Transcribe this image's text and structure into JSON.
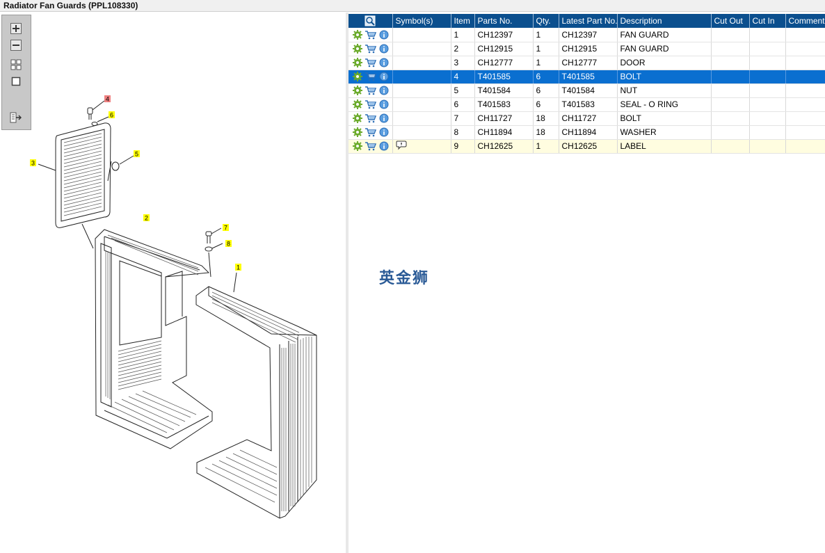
{
  "window": {
    "title": "Radiator Fan Guards (PPL108330)"
  },
  "toolbar": {
    "buttons": [
      {
        "name": "zoom-in",
        "icon": "plus-icon"
      },
      {
        "name": "zoom-out",
        "icon": "minus-icon"
      },
      {
        "name": "fit-all",
        "icon": "grid-icon"
      },
      {
        "name": "fit-window",
        "icon": "square-icon"
      },
      {
        "name": "export",
        "icon": "export-icon"
      }
    ]
  },
  "callouts": [
    {
      "label": "4",
      "selected": true
    },
    {
      "label": "6",
      "selected": false
    },
    {
      "label": "5",
      "selected": false
    },
    {
      "label": "3",
      "selected": false
    },
    {
      "label": "2",
      "selected": false
    },
    {
      "label": "7",
      "selected": false
    },
    {
      "label": "8",
      "selected": false
    },
    {
      "label": "1",
      "selected": false
    }
  ],
  "table": {
    "columns": [
      "",
      "Symbol(s)",
      "Item",
      "Parts No.",
      "Qty.",
      "Latest Part No.",
      "Description",
      "Cut Out",
      "Cut In",
      "Comment"
    ],
    "rows": [
      {
        "item": "1",
        "part": "CH12397",
        "qty": "1",
        "latest": "CH12397",
        "desc": "FAN GUARD",
        "symbol": ""
      },
      {
        "item": "2",
        "part": "CH12915",
        "qty": "1",
        "latest": "CH12915",
        "desc": "FAN GUARD",
        "symbol": ""
      },
      {
        "item": "3",
        "part": "CH12777",
        "qty": "1",
        "latest": "CH12777",
        "desc": "DOOR",
        "symbol": ""
      },
      {
        "item": "4",
        "part": "T401585",
        "qty": "6",
        "latest": "T401585",
        "desc": "BOLT",
        "symbol": "",
        "selected": true
      },
      {
        "item": "5",
        "part": "T401584",
        "qty": "6",
        "latest": "T401584",
        "desc": "NUT",
        "symbol": ""
      },
      {
        "item": "6",
        "part": "T401583",
        "qty": "6",
        "latest": "T401583",
        "desc": "SEAL - O RING",
        "symbol": ""
      },
      {
        "item": "7",
        "part": "CH11727",
        "qty": "18",
        "latest": "CH11727",
        "desc": "BOLT",
        "symbol": ""
      },
      {
        "item": "8",
        "part": "CH11894",
        "qty": "18",
        "latest": "CH11894",
        "desc": "WASHER",
        "symbol": ""
      },
      {
        "item": "9",
        "part": "CH12625",
        "qty": "1",
        "latest": "CH12625",
        "desc": "LABEL",
        "symbol": "comment-icon",
        "highlight": true
      }
    ]
  },
  "watermark": "英金狮",
  "colors": {
    "header": "#0b4f8e",
    "selected": "#0a6fd0",
    "highlight": "#fffde0",
    "callout": "#ffff00",
    "callout_selected": "#f08080"
  }
}
